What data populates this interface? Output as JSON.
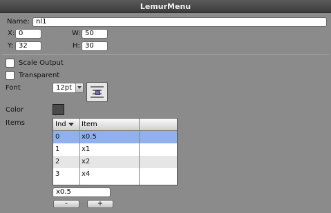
{
  "window": {
    "title": "LemurMenu"
  },
  "name": {
    "label": "Name:",
    "value": "nl1"
  },
  "geometry": {
    "x_label": "X:",
    "x_value": "0",
    "y_label": "Y:",
    "y_value": "32",
    "w_label": "W:",
    "w_value": "50",
    "h_label": "H:",
    "h_value": "30"
  },
  "options": {
    "scale_output": {
      "label": "Scale Output",
      "checked": false
    },
    "transparent": {
      "label": "Transparent",
      "checked": false
    }
  },
  "font": {
    "label": "Font",
    "size": "12pt"
  },
  "color": {
    "label": "Color",
    "value": "#4a4a4a"
  },
  "items": {
    "label": "Items",
    "columns": [
      "Ind",
      "Item",
      ""
    ],
    "rows": [
      {
        "ind": "0",
        "item": "x0.5"
      },
      {
        "ind": "1",
        "item": "x1"
      },
      {
        "ind": "2",
        "item": "x2"
      },
      {
        "ind": "3",
        "item": "x4"
      }
    ],
    "selected_index": 0
  },
  "edit": {
    "value": "x0.5"
  },
  "buttons": {
    "minus": "-",
    "plus": "+"
  },
  "colors": {
    "selection": "#8fb2ef",
    "background": "#8b8b8b"
  }
}
